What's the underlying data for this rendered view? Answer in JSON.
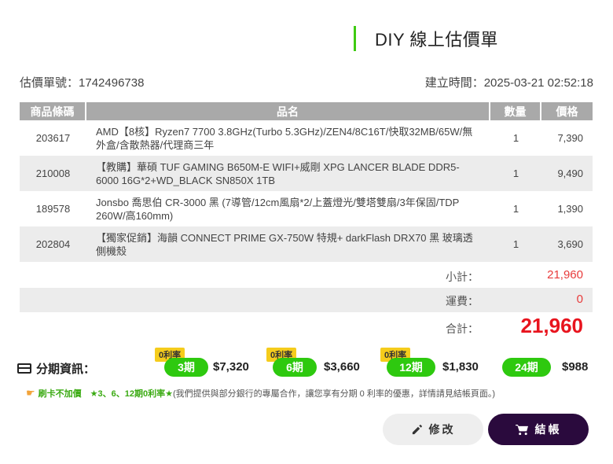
{
  "header": {
    "title": "DIY 線上估價單"
  },
  "meta": {
    "quote_no_label": "估價單號：",
    "quote_no": "1742496738",
    "created_label": "建立時間：",
    "created_at": "2025-03-21 02:52:18"
  },
  "table": {
    "columns": [
      "商品條碼",
      "品名",
      "數量",
      "價格"
    ],
    "rows": [
      {
        "code": "203617",
        "name": "AMD【8核】Ryzen7 7700 3.8GHz(Turbo 5.3GHz)/ZEN4/8C16T/快取32MB/65W/無外盒/含散熱器/代理商三年",
        "qty": "1",
        "price": "7,390"
      },
      {
        "code": "210008",
        "name": "【教購】華碩 TUF GAMING B650M-E WIFI+威剛 XPG LANCER BLADE DDR5-6000 16G*2+WD_BLACK SN850X 1TB",
        "qty": "1",
        "price": "9,490"
      },
      {
        "code": "189578",
        "name": "Jonsbo 喬思伯 CR-3000 黑 (7導管/12cm風扇*2/上蓋燈光/雙塔雙扇/3年保固/TDP 260W/高160mm)",
        "qty": "1",
        "price": "1,390"
      },
      {
        "code": "202804",
        "name": "【獨家促銷】海韻 CONNECT PRIME GX-750W 特規+ darkFlash DRX70 黑 玻璃透側機殼",
        "qty": "1",
        "price": "3,690"
      }
    ]
  },
  "summary": {
    "subtotal_label": "小計：",
    "subtotal": "21,960",
    "shipping_label": "運費：",
    "shipping": "0",
    "total_label": "合計：",
    "total": "21,960"
  },
  "installment": {
    "title": "分期資訊：",
    "plans": [
      {
        "badge": "0利率",
        "period": "3期",
        "amount": "$7,320"
      },
      {
        "badge": "0利率",
        "period": "6期",
        "amount": "$3,660"
      },
      {
        "badge": "0利率",
        "period": "12期",
        "amount": "$1,830"
      },
      {
        "badge": "",
        "period": "24期",
        "amount": "$988"
      }
    ]
  },
  "note": {
    "highlight": "刷卡不加價　★3、6、12期0利率★",
    "text": "(我們提供與部分銀行的專屬合作，讓您享有分期 0 利率的優惠，詳情請見結帳頁面。)"
  },
  "buttons": {
    "edit": "修改",
    "checkout": "結帳"
  },
  "colors": {
    "accent_green": "#2ec90f",
    "total_red": "#e8141e",
    "checkout_bg": "#2a0a3d",
    "badge_yellow": "#f5cc1c"
  }
}
